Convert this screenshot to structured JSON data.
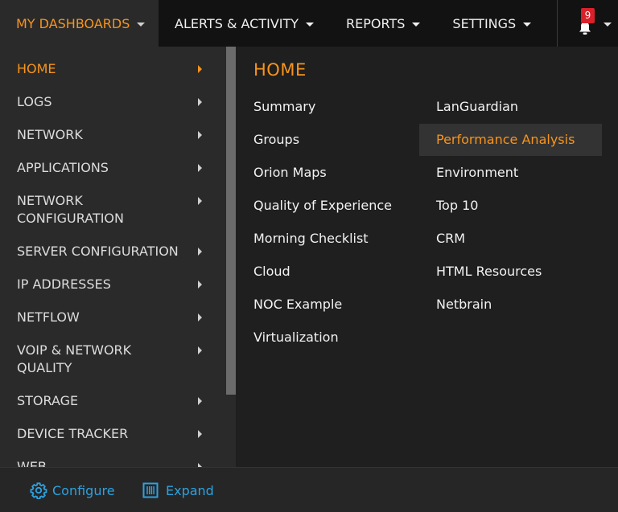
{
  "topnav": {
    "items": [
      {
        "label": "MY DASHBOARDS"
      },
      {
        "label": "ALERTS & ACTIVITY"
      },
      {
        "label": "REPORTS"
      },
      {
        "label": "SETTINGS"
      }
    ],
    "notifications_count": "9"
  },
  "sidebar": {
    "items": [
      {
        "label": "HOME"
      },
      {
        "label": "LOGS"
      },
      {
        "label": "NETWORK"
      },
      {
        "label": "APPLICATIONS"
      },
      {
        "label": "NETWORK CONFIGURATION"
      },
      {
        "label": "SERVER CONFIGURATION"
      },
      {
        "label": "IP ADDRESSES"
      },
      {
        "label": "NETFLOW"
      },
      {
        "label": "VOIP & NETWORK QUALITY"
      },
      {
        "label": "STORAGE"
      },
      {
        "label": "DEVICE TRACKER"
      },
      {
        "label": "WEB"
      }
    ]
  },
  "content": {
    "title": "HOME",
    "col1": [
      "Summary",
      "Groups",
      "Orion Maps",
      "Quality of Experience",
      "Morning Checklist",
      "Cloud",
      "NOC Example",
      "Virtualization"
    ],
    "col2": [
      "LanGuardian",
      "Performance Analysis",
      "Environment",
      "Top 10",
      "CRM",
      "HTML Resources",
      "Netbrain"
    ]
  },
  "footer": {
    "configure_label": "Configure",
    "expand_label": "Expand"
  },
  "colors": {
    "accent": "#f7941d",
    "link_blue": "#2ea2e0",
    "badge_red": "#d9212a"
  }
}
